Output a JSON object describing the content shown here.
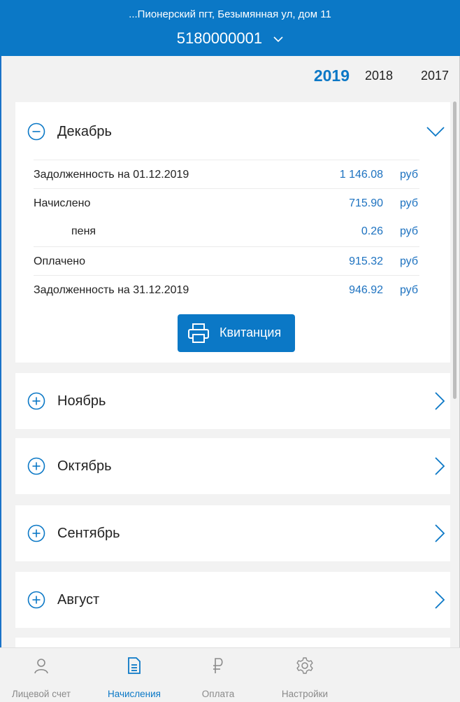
{
  "header": {
    "address": "...Пионерский пгт, Безымянная ул, дом 11",
    "account": "5180000001"
  },
  "years": [
    "2019",
    "2018",
    "2017"
  ],
  "selected_year": "2019",
  "expanded": {
    "month": "Декабрь",
    "rows": [
      {
        "label": "Задолженность на 01.12.2019",
        "value": "1 146.08",
        "unit": "руб"
      },
      {
        "label": "Начислено",
        "value": "715.90",
        "unit": "руб"
      },
      {
        "label": "пеня",
        "value": "0.26",
        "unit": "руб"
      },
      {
        "label": "Оплачено",
        "value": "915.32",
        "unit": "руб"
      },
      {
        "label": "Задолженность на 31.12.2019",
        "value": "946.92",
        "unit": "руб"
      }
    ],
    "receipt_button": "Квитанция"
  },
  "collapsed_months": [
    "Ноябрь",
    "Октябрь",
    "Сентябрь",
    "Август"
  ],
  "tabs": [
    {
      "label": "Лицевой счет",
      "icon": "person-icon"
    },
    {
      "label": "Начисления",
      "icon": "document-icon"
    },
    {
      "label": "Оплата",
      "icon": "ruble-icon"
    },
    {
      "label": "Настройки",
      "icon": "gear-icon"
    }
  ],
  "active_tab": "Начисления",
  "colors": {
    "accent": "#0b78c6",
    "value": "#1d72c0",
    "background": "#f2f2f2"
  }
}
